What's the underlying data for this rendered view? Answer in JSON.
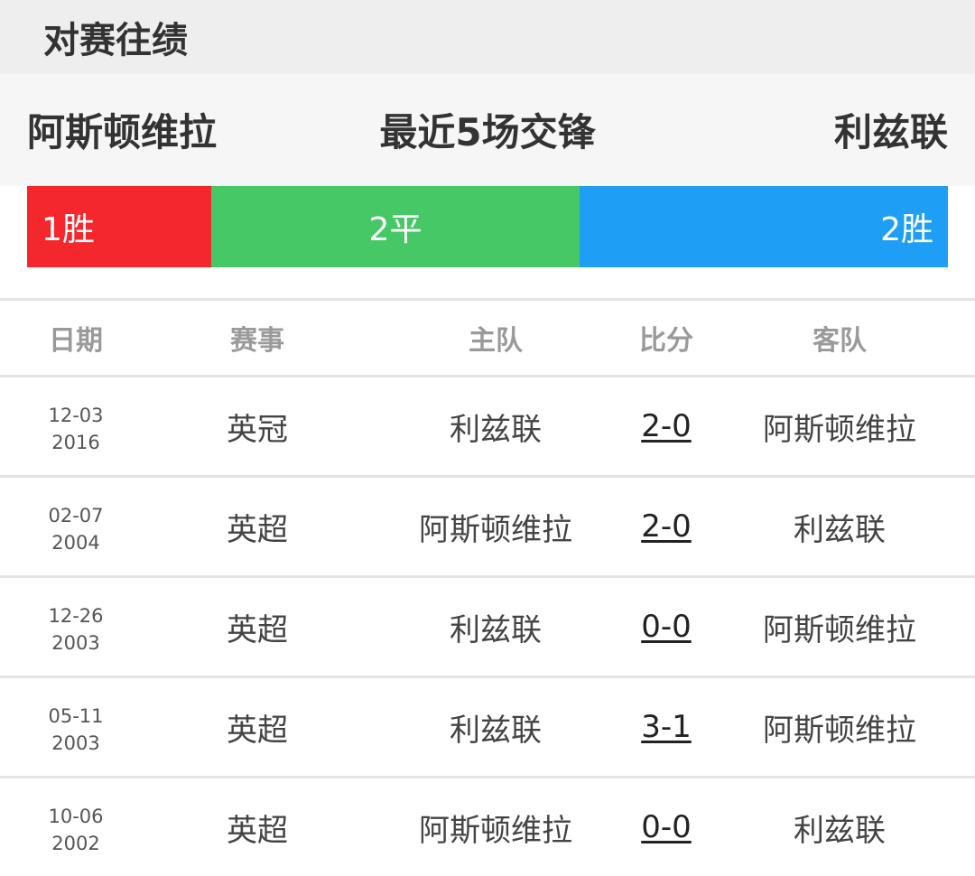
{
  "section": {
    "title": "对赛往绩"
  },
  "teams": {
    "home": "阿斯顿维拉",
    "middle": "最近5场交锋",
    "away": "利兹联"
  },
  "summary": {
    "win": {
      "label": "1胜",
      "count": 1,
      "color": "#f3272c"
    },
    "draw": {
      "label": "2平",
      "count": 2,
      "color": "#46c867"
    },
    "loss": {
      "label": "2胜",
      "count": 2,
      "color": "#1e9ff5"
    }
  },
  "table": {
    "headers": {
      "date": "日期",
      "competition": "赛事",
      "home": "主队",
      "score": "比分",
      "away": "客队"
    },
    "rows": [
      {
        "date_md": "12-03",
        "date_year": "2016",
        "competition": "英冠",
        "home": "利兹联",
        "score": "2-0",
        "away": "阿斯顿维拉"
      },
      {
        "date_md": "02-07",
        "date_year": "2004",
        "competition": "英超",
        "home": "阿斯顿维拉",
        "score": "2-0",
        "away": "利兹联"
      },
      {
        "date_md": "12-26",
        "date_year": "2003",
        "competition": "英超",
        "home": "利兹联",
        "score": "0-0",
        "away": "阿斯顿维拉"
      },
      {
        "date_md": "05-11",
        "date_year": "2003",
        "competition": "英超",
        "home": "利兹联",
        "score": "3-1",
        "away": "阿斯顿维拉"
      },
      {
        "date_md": "10-06",
        "date_year": "2002",
        "competition": "英超",
        "home": "阿斯顿维拉",
        "score": "0-0",
        "away": "利兹联"
      }
    ]
  }
}
